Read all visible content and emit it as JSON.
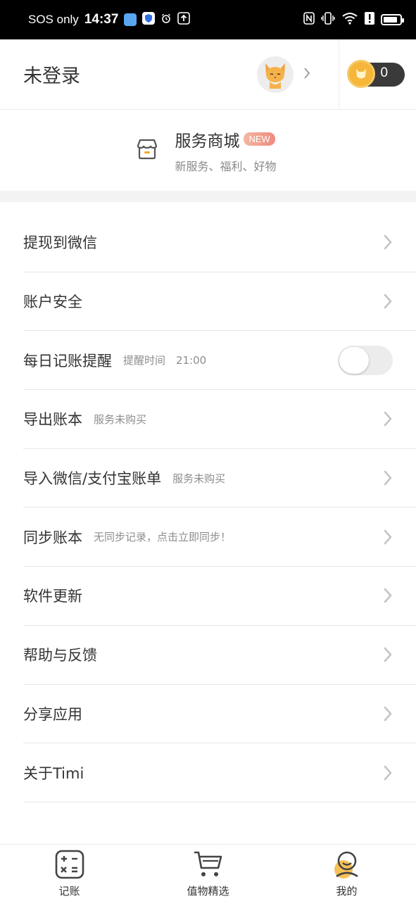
{
  "status_bar": {
    "carrier": "SOS only",
    "time": "14:37",
    "left_icons": [
      "gallery-app-icon",
      "shield-app-icon",
      "alarm-icon",
      "upload-icon"
    ],
    "right_icons": [
      "nfc-icon",
      "vibrate-icon",
      "wifi-icon",
      "alert-icon",
      "battery-icon"
    ],
    "battery_level": 0.85
  },
  "header": {
    "login_status": "未登录",
    "avatar_icon": "cat-avatar-icon",
    "coin_count": "0",
    "coin_icon": "cat-coin-icon"
  },
  "mall": {
    "title": "服务商城",
    "badge": "NEW",
    "subtitle": "新服务、福利、好物",
    "icon": "store-icon"
  },
  "menu": {
    "items": [
      {
        "label": "提现到微信",
        "hint": "",
        "control": "chevron"
      },
      {
        "label": "账户安全",
        "hint": "",
        "control": "chevron"
      },
      {
        "label": "每日记账提醒",
        "hint": "提醒时间　21:00",
        "control": "toggle",
        "toggle_on": false
      },
      {
        "label": "导出账本",
        "hint": "服务未购买",
        "control": "chevron"
      },
      {
        "label": "导入微信/支付宝账单",
        "hint": "服务未购买",
        "control": "chevron"
      },
      {
        "label": "同步账本",
        "hint": "无同步记录，点击立即同步！",
        "control": "chevron"
      },
      {
        "label": "软件更新",
        "hint": "",
        "control": "chevron"
      },
      {
        "label": "帮助与反馈",
        "hint": "",
        "control": "chevron"
      },
      {
        "label": "分享应用",
        "hint": "",
        "control": "chevron"
      },
      {
        "label": "关于Timi",
        "hint": "",
        "control": "chevron"
      }
    ]
  },
  "bottom_nav": {
    "items": [
      {
        "label": "记账",
        "icon": "calculator-icon"
      },
      {
        "label": "值物精选",
        "icon": "cart-icon"
      },
      {
        "label": "我的",
        "icon": "profile-icon",
        "active": true
      }
    ]
  },
  "colors": {
    "status_bar_bg": "#000000",
    "coin_gold": "#f5b63a",
    "coin_pill_bg": "#3a3a3a",
    "new_badge": "#ef8a7f",
    "divider_band": "#f3f3f3",
    "chevron": "#c4c4c4",
    "active_nav_accent": "#f5b63a"
  }
}
